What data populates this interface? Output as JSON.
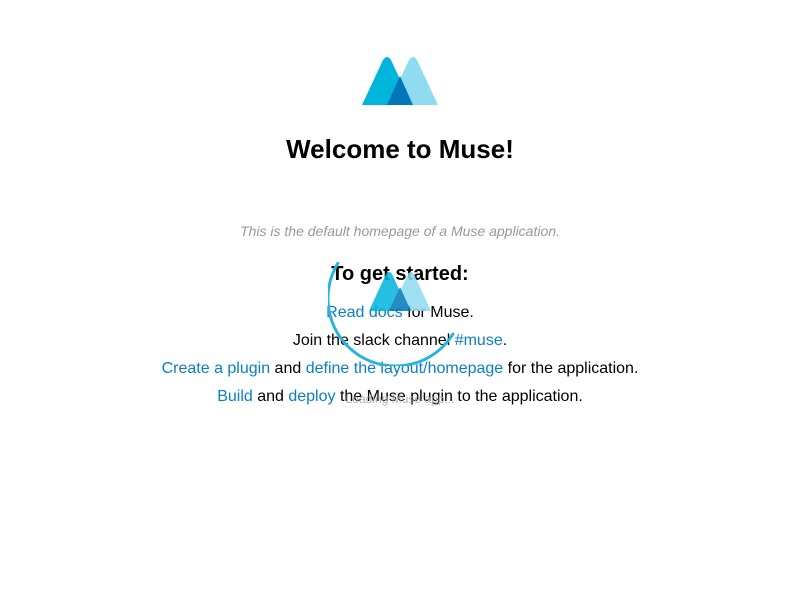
{
  "welcome": {
    "title": "Welcome to Muse!",
    "description": "This is the default homepage of a Muse application.",
    "logo_icon": "muse-logo-icon"
  },
  "getting_started": {
    "heading": "To get started:",
    "line1": {
      "link": "Read docs",
      "text": " for Muse."
    },
    "line2": {
      "text": "Join the slack channel ",
      "link": "#muse",
      "suffix": "."
    },
    "line3": {
      "link1": "Create a plugin",
      "text1": " and ",
      "link2": "define the layout/homepage",
      "text2": " for the application."
    },
    "line4": {
      "link1": "Build",
      "text1": " and ",
      "link2": "deploy",
      "text2": " the Muse plugin to the application."
    }
  },
  "loading": {
    "text": "Loading Muse app...",
    "icon": "loading-spinner-icon"
  },
  "colors": {
    "link": "#0a7fc5",
    "logo_light": "#8fdcf0",
    "logo_mid": "#00b4dc",
    "logo_dark": "#0077b9",
    "muted_text": "#999999"
  }
}
